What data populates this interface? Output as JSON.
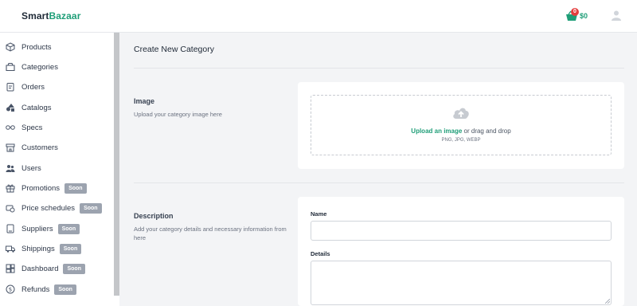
{
  "header": {
    "brand_part1": "Smart",
    "brand_part2": "Bazaar",
    "cart_count": "0",
    "cart_total": "$0",
    "brand_color": "#1f9e78",
    "cart_icon": "shopping-basket-icon",
    "avatar_icon": "user-icon"
  },
  "sidebar": {
    "items": [
      {
        "label": "Products",
        "icon": "box-icon",
        "badge": ""
      },
      {
        "label": "Categories",
        "icon": "folder-icon",
        "badge": ""
      },
      {
        "label": "Orders",
        "icon": "clipboard-icon",
        "badge": ""
      },
      {
        "label": "Catalogs",
        "icon": "shapes-icon",
        "badge": ""
      },
      {
        "label": "Specs",
        "icon": "specs-icon",
        "badge": ""
      },
      {
        "label": "Customers",
        "icon": "store-icon",
        "badge": ""
      },
      {
        "label": "Users",
        "icon": "users-icon",
        "badge": ""
      },
      {
        "label": "Promotions",
        "icon": "gift-icon",
        "badge": "Soon"
      },
      {
        "label": "Price schedules",
        "icon": "price-schedule-icon",
        "badge": "Soon"
      },
      {
        "label": "Suppliers",
        "icon": "supplier-icon",
        "badge": "Soon"
      },
      {
        "label": "Shippings",
        "icon": "truck-icon",
        "badge": "Soon"
      },
      {
        "label": "Dashboard",
        "icon": "dashboard-icon",
        "badge": "Soon"
      },
      {
        "label": "Refunds",
        "icon": "refund-icon",
        "badge": "Soon"
      }
    ]
  },
  "main": {
    "title": "Create New Category",
    "image_section": {
      "title": "Image",
      "description": "Upload your category image here",
      "upload_link": "Upload an image",
      "upload_rest": " or drag and drop",
      "file_types": "PNG, JPG, WEBP"
    },
    "description_section": {
      "title": "Description",
      "description": "Add your category details and necessary information from here",
      "name_label": "Name",
      "name_value": "",
      "details_label": "Details",
      "details_value": ""
    }
  }
}
